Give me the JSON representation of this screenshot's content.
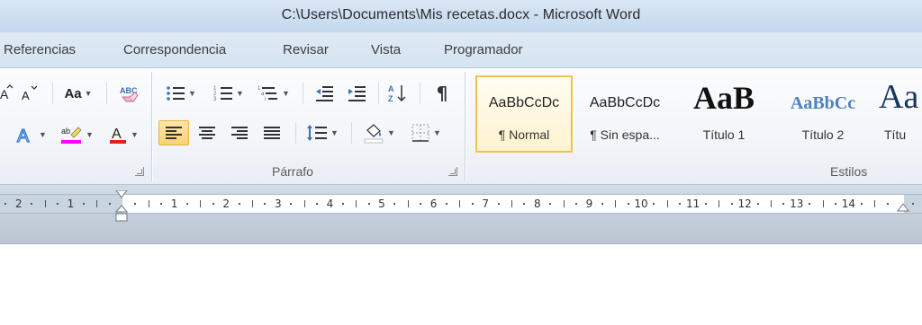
{
  "window": {
    "title": "C:\\Users\\Documents\\Mis recetas.docx  -  Microsoft Word"
  },
  "tabs": [
    "Referencias",
    "Correspondencia",
    "Revisar",
    "Vista",
    "Programador"
  ],
  "groups": {
    "paragraph_label": "Párrafo",
    "styles_label": "Estilos"
  },
  "font_controls": {
    "change_case_label": "Aa"
  },
  "styles": [
    {
      "preview": "AaBbCcDc",
      "name": "¶ Normal"
    },
    {
      "preview": "AaBbCcDc",
      "name": "¶ Sin espa..."
    },
    {
      "preview": "AaB",
      "name": "Título 1"
    },
    {
      "preview": "AaBbCc",
      "name": "Título 2"
    },
    {
      "preview": "Aa",
      "name": "Títu"
    }
  ],
  "ruler": {
    "left_labels": [
      "2",
      "1"
    ],
    "right_labels": [
      "1",
      "2",
      "3",
      "4",
      "5",
      "6",
      "7",
      "8",
      "9",
      "10",
      "11",
      "12",
      "13",
      "14"
    ]
  },
  "colors": {
    "accent": "#f9d36e",
    "highlight": "#ff00ff",
    "font_color": "#e0201b",
    "heading2": "#4f81bd",
    "heading_big": "#17365d"
  },
  "icons": [
    "grow-font-icon",
    "shrink-font-icon",
    "change-case-icon",
    "clear-format-icon",
    "text-effects-icon",
    "highlight-icon",
    "font-color-icon",
    "bullets-icon",
    "numbering-icon",
    "multilevel-list-icon",
    "decrease-indent-icon",
    "increase-indent-icon",
    "sort-icon",
    "show-marks-icon",
    "align-left-icon",
    "align-center-icon",
    "align-right-icon",
    "justify-icon",
    "line-spacing-icon",
    "shading-icon",
    "borders-icon"
  ]
}
